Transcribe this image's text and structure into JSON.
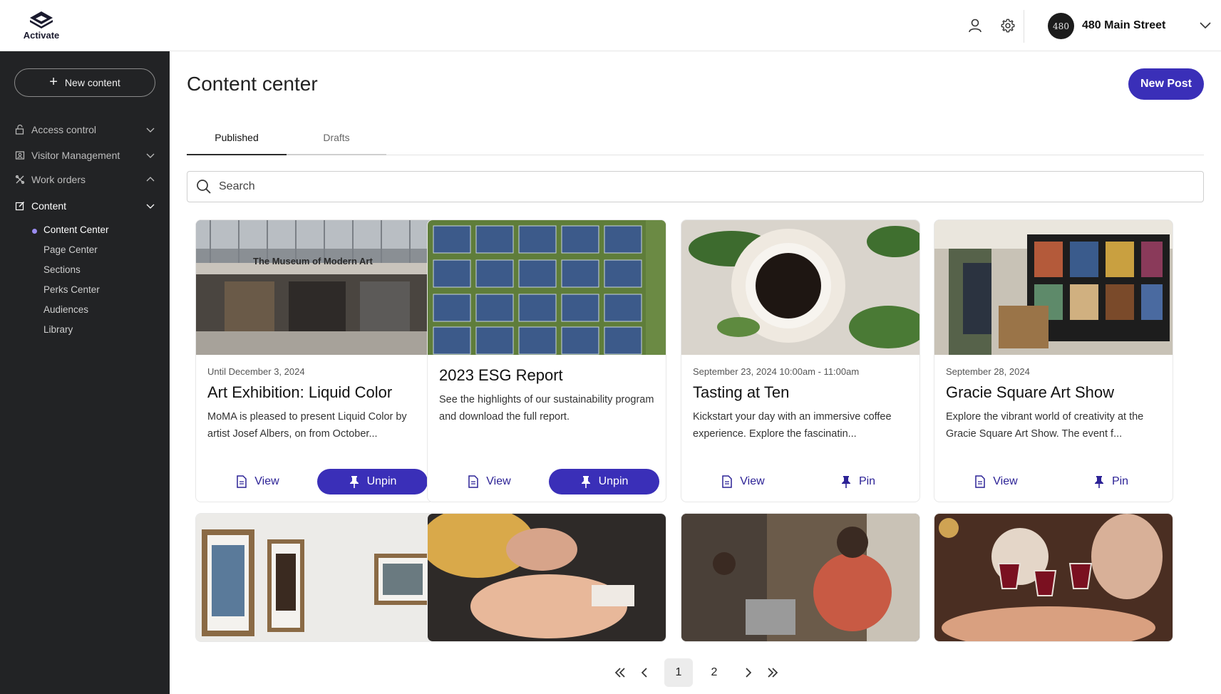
{
  "brand": {
    "name": "Activate"
  },
  "header": {
    "building_name": "480 Main Street",
    "avatar_text": "480",
    "icons": [
      "user-icon",
      "settings-gear-icon",
      "chevron-down-icon"
    ]
  },
  "sidebar": {
    "new_content_label": "New content",
    "nav": [
      {
        "label": "Access control",
        "icon": "lock-icon",
        "expanded": false
      },
      {
        "label": "Visitor Management",
        "icon": "visitor-badge-icon",
        "expanded": false
      },
      {
        "label": "Work orders",
        "icon": "tools-icon",
        "expanded": true
      },
      {
        "label": "Content",
        "icon": "edit-icon",
        "expanded": true
      }
    ],
    "content_subitems": [
      "Content Center",
      "Page Center",
      "Sections",
      "Perks Center",
      "Audiences",
      "Library"
    ],
    "active_subitem": "Content Center"
  },
  "main": {
    "title": "Content center",
    "new_post_label": "New Post",
    "tabs": [
      {
        "label": "Published",
        "active": true
      },
      {
        "label": "Drafts",
        "active": false
      }
    ],
    "search_placeholder": "Search",
    "cards": [
      {
        "meta": "Until December 3, 2024",
        "title": "Art Exhibition: Liquid Color",
        "description": "MoMA is pleased to present Liquid Color by artist Josef Albers, on from October...",
        "view_label": "View",
        "pin_label": "Unpin",
        "pinned": true,
        "image_caption": "The Museum of Modern Art"
      },
      {
        "meta": "",
        "title": "2023 ESG Report",
        "description": "See the highlights of our sustainability program and download the full report.",
        "view_label": "View",
        "pin_label": "Unpin",
        "pinned": true
      },
      {
        "meta": "September 23, 2024 10:00am - 11:00am",
        "title": "Tasting at Ten",
        "description": "Kickstart your day with an immersive coffee experience. Explore the fascinatin...",
        "view_label": "View",
        "pin_label": "Pin",
        "pinned": false
      },
      {
        "meta": "September 28, 2024",
        "title": "Gracie Square Art Show",
        "description": "Explore the vibrant world of creativity at the Gracie Square Art Show. The event f...",
        "view_label": "View",
        "pin_label": "Pin",
        "pinned": false
      }
    ],
    "pagination": {
      "current": "1",
      "pages": [
        "1",
        "2"
      ]
    }
  },
  "colors": {
    "accent": "#3a2fb8",
    "sidebar_bg": "#222325",
    "active_dot": "#9b8cf0"
  }
}
